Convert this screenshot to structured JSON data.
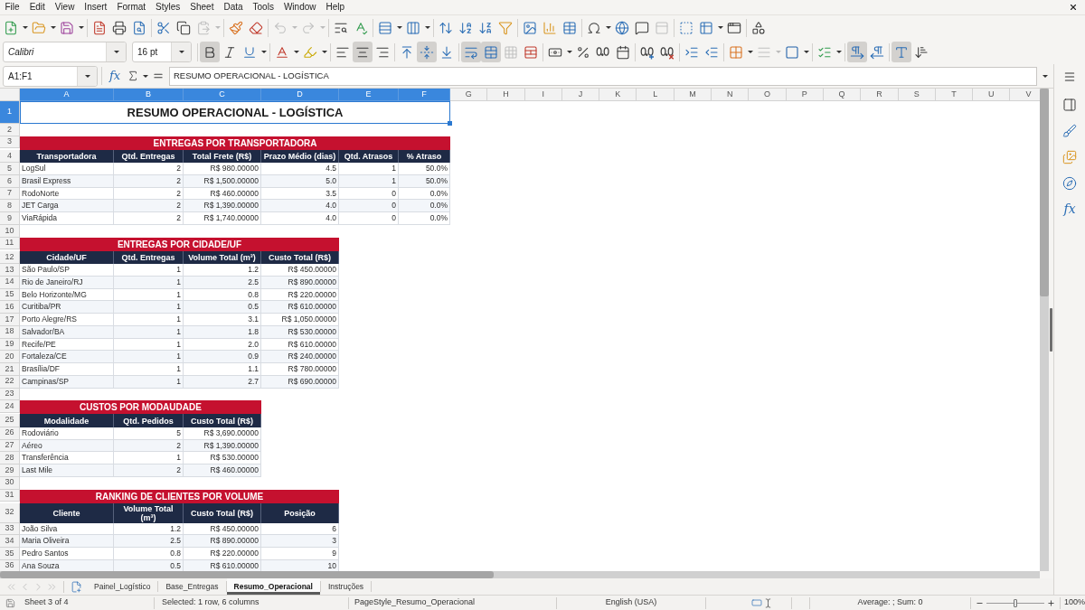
{
  "menu_bar": {
    "items": [
      "File",
      "Edit",
      "View",
      "Insert",
      "Format",
      "Styles",
      "Sheet",
      "Data",
      "Tools",
      "Window",
      "Help"
    ]
  },
  "standard_toolbar": {
    "paste": {
      "disabled": true
    },
    "undo": {
      "disabled": true
    },
    "redo": {
      "disabled": true
    },
    "header_footer": {
      "disabled": true
    }
  },
  "formatting_toolbar": {
    "font_name": "Calibri",
    "font_size": "16 pt",
    "bold": {
      "active": true
    },
    "italic": {
      "active": false
    },
    "underline": {
      "active": false
    },
    "align_left": {
      "active": false
    },
    "align_center": {
      "active": true
    },
    "align_right": {
      "active": false
    },
    "align_top": {
      "active": false
    },
    "align_middle": {
      "active": true
    },
    "align_bottom": {
      "active": false
    },
    "wrap_text": {
      "active": true
    },
    "merge_and_center": {
      "active": true
    },
    "merge_cells": {
      "disabled": true
    },
    "border_style": {
      "disabled": true
    },
    "left_to_right": {
      "active": true
    },
    "right_to_left": {
      "active": false
    },
    "text_horizontal": {
      "active": true
    },
    "text_vertical": {
      "active": false
    }
  },
  "formula_bar": {
    "name_box": "A1:F1",
    "function_wizard": "fx",
    "content": "RESUMO OPERACIONAL - LOGÍSTICA"
  },
  "sheet": {
    "columns": [
      {
        "label": "A",
        "selected": true
      },
      {
        "label": "B",
        "selected": true
      },
      {
        "label": "C",
        "selected": true
      },
      {
        "label": "D",
        "selected": true
      },
      {
        "label": "E",
        "selected": true
      },
      {
        "label": "F",
        "selected": true
      },
      {
        "label": "G",
        "selected": false
      },
      {
        "label": "H",
        "selected": false
      },
      {
        "label": "I",
        "selected": false
      },
      {
        "label": "J",
        "selected": false
      },
      {
        "label": "K",
        "selected": false
      },
      {
        "label": "L",
        "selected": false
      },
      {
        "label": "M",
        "selected": false
      },
      {
        "label": "N",
        "selected": false
      },
      {
        "label": "O",
        "selected": false
      },
      {
        "label": "P",
        "selected": false
      },
      {
        "label": "Q",
        "selected": false
      },
      {
        "label": "R",
        "selected": false
      },
      {
        "label": "S",
        "selected": false
      },
      {
        "label": "T",
        "selected": false
      },
      {
        "label": "U",
        "selected": false
      },
      {
        "label": "V",
        "selected": false
      }
    ],
    "rows": [
      {
        "label": "1",
        "selected": true
      },
      {
        "label": "2",
        "selected": false
      },
      {
        "label": "3",
        "selected": false
      },
      {
        "label": "4",
        "selected": false
      },
      {
        "label": "5",
        "selected": false
      },
      {
        "label": "6",
        "selected": false
      },
      {
        "label": "7",
        "selected": false
      },
      {
        "label": "8",
        "selected": false
      },
      {
        "label": "9",
        "selected": false
      },
      {
        "label": "10",
        "selected": false
      },
      {
        "label": "11",
        "selected": false
      },
      {
        "label": "12",
        "selected": false
      },
      {
        "label": "13",
        "selected": false
      },
      {
        "label": "14",
        "selected": false
      },
      {
        "label": "15",
        "selected": false
      },
      {
        "label": "16",
        "selected": false
      },
      {
        "label": "17",
        "selected": false
      },
      {
        "label": "18",
        "selected": false
      },
      {
        "label": "19",
        "selected": false
      },
      {
        "label": "20",
        "selected": false
      },
      {
        "label": "21",
        "selected": false
      },
      {
        "label": "22",
        "selected": false
      },
      {
        "label": "23",
        "selected": false
      },
      {
        "label": "24",
        "selected": false
      },
      {
        "label": "25",
        "selected": false
      },
      {
        "label": "26",
        "selected": false
      },
      {
        "label": "27",
        "selected": false
      },
      {
        "label": "28",
        "selected": false
      },
      {
        "label": "29",
        "selected": false
      },
      {
        "label": "30",
        "selected": false
      },
      {
        "label": "31",
        "selected": false
      },
      {
        "label": "32",
        "selected": false
      },
      {
        "label": "33",
        "selected": false
      },
      {
        "label": "34",
        "selected": false
      },
      {
        "label": "35",
        "selected": false
      },
      {
        "label": "36",
        "selected": false
      }
    ],
    "title": {
      "text": "RESUMO OPERACIONAL - LOGÍSTICA",
      "selected": true
    },
    "tables": [
      {
        "title": "ENTREGAS POR TRANSPORTADORA",
        "columns": [
          "Transportadora",
          "Qtd. Entregas",
          "Total Frete (R$)",
          "Prazo Médio (dias)",
          "Qtd. Atrasos",
          "% Atraso"
        ],
        "rows": [
          [
            "LogSul",
            "2",
            "R$ 980.00000",
            "4.5",
            "1",
            "50.0%"
          ],
          [
            "Brasil Express",
            "2",
            "R$ 1,500.00000",
            "5.0",
            "1",
            "50.0%"
          ],
          [
            "RodoNorte",
            "2",
            "R$ 460.00000",
            "3.5",
            "0",
            "0.0%"
          ],
          [
            "JET Carga",
            "2",
            "R$ 1,390.00000",
            "4.0",
            "0",
            "0.0%"
          ],
          [
            "ViaRápida",
            "2",
            "R$ 1,740.00000",
            "4.0",
            "0",
            "0.0%"
          ]
        ]
      },
      {
        "title": "ENTREGAS POR CIDADE/UF",
        "columns": [
          "Cidade/UF",
          "Qtd. Entregas",
          "Volume Total (m³)",
          "Custo Total (R$)"
        ],
        "rows": [
          [
            "São Paulo/SP",
            "1",
            "1.2",
            "R$ 450.00000"
          ],
          [
            "Rio de Janeiro/RJ",
            "1",
            "2.5",
            "R$ 890.00000"
          ],
          [
            "Belo Horizonte/MG",
            "1",
            "0.8",
            "R$ 220.00000"
          ],
          [
            "Curitiba/PR",
            "1",
            "0.5",
            "R$ 610.00000"
          ],
          [
            "Porto Alegre/RS",
            "1",
            "3.1",
            "R$ 1,050.00000"
          ],
          [
            "Salvador/BA",
            "1",
            "1.8",
            "R$ 530.00000"
          ],
          [
            "Recife/PE",
            "1",
            "2.0",
            "R$ 610.00000"
          ],
          [
            "Fortaleza/CE",
            "1",
            "0.9",
            "R$ 240.00000"
          ],
          [
            "Brasília/DF",
            "1",
            "1.1",
            "R$ 780.00000"
          ],
          [
            "Campinas/SP",
            "1",
            "2.7",
            "R$ 690.00000"
          ]
        ]
      },
      {
        "title": "CUSTOS POR MODAUDADE",
        "columns": [
          "Modalidade",
          "Qtd. Pedidos",
          "Custo Total (R$)"
        ],
        "rows": [
          [
            "Rodoviário",
            "5",
            "R$ 3,690.00000"
          ],
          [
            "Aéreo",
            "2",
            "R$ 1,390.00000"
          ],
          [
            "Transferência",
            "1",
            "R$ 530.00000"
          ],
          [
            "Last Mile",
            "2",
            "R$ 460.00000"
          ]
        ]
      },
      {
        "title": "RANKING DE CLIENTES POR VOLUME",
        "columns": [
          "Cliente",
          "Volume Total (m³)",
          "Custo Total (R$)",
          "Posição"
        ],
        "rows": [
          [
            "João Silva",
            "1.2",
            "R$ 450.00000",
            "6"
          ],
          [
            "Maria Oliveira",
            "2.5",
            "R$ 890.00000",
            "3"
          ],
          [
            "Pedro Santos",
            "0.8",
            "R$ 220.00000",
            "9"
          ],
          [
            "Ana Souza",
            "0.5",
            "R$ 610.00000",
            "10"
          ]
        ]
      }
    ]
  },
  "sheet_tabs": {
    "navigation_disabled": true,
    "tabs": [
      {
        "label": "Painel_Logístico",
        "selected": false
      },
      {
        "label": "Base_Entregas",
        "selected": false
      },
      {
        "label": "Resumo_Operacional",
        "selected": true
      },
      {
        "label": "Instruções",
        "selected": false
      }
    ]
  },
  "sidebar": {
    "functions": "fx"
  },
  "status_bar": {
    "sheet_position": "Sheet 3 of 4",
    "selection": "Selected: 1 row, 6 columns",
    "page_style": "PageStyle_Resumo_Operacional",
    "language": "English (USA)",
    "summary": "Average: ; Sum: 0",
    "zoom": {
      "level": 0.5,
      "reading": "100%"
    }
  }
}
